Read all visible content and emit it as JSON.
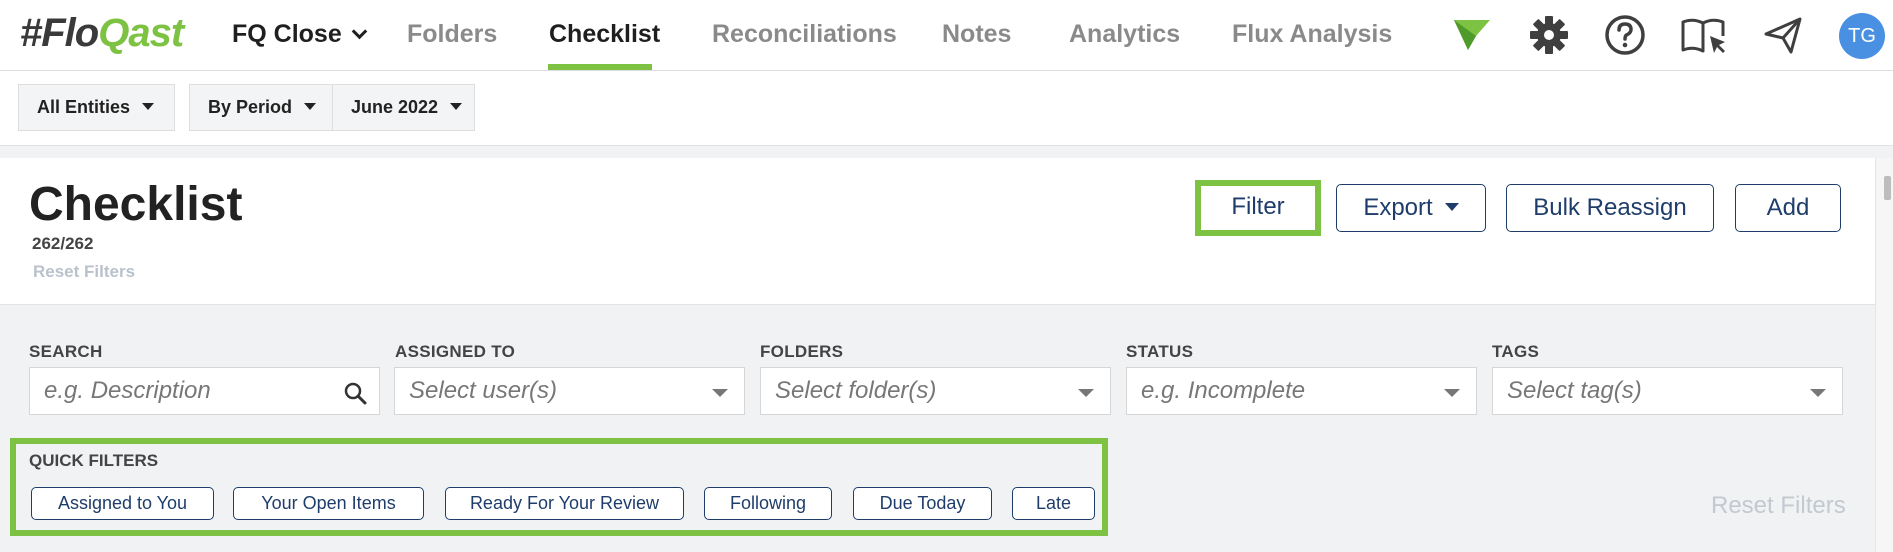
{
  "nav": {
    "logo_hash": "#",
    "logo_flo": "Flo",
    "logo_qast": "Qast",
    "workspace": "FQ Close",
    "tabs": [
      "Folders",
      "Checklist",
      "Reconciliations",
      "Notes",
      "Analytics",
      "Flux Analysis"
    ],
    "active_tab": "Checklist",
    "avatar_initials": "TG",
    "icons": [
      "brand-flag-icon",
      "gear-icon",
      "help-icon",
      "guide-book-icon",
      "send-icon"
    ]
  },
  "subbar": {
    "entities": "All Entities",
    "period_mode": "By Period",
    "period": "June 2022"
  },
  "header": {
    "title": "Checklist",
    "count": "262/262",
    "reset_filters": "Reset Filters",
    "buttons": {
      "filter": "Filter",
      "export": "Export",
      "bulk_reassign": "Bulk Reassign",
      "add": "Add"
    }
  },
  "filters": {
    "search": {
      "label": "SEARCH",
      "placeholder": "e.g. Description"
    },
    "assigned_to": {
      "label": "ASSIGNED TO",
      "placeholder": "Select user(s)"
    },
    "folders": {
      "label": "FOLDERS",
      "placeholder": "Select folder(s)"
    },
    "status": {
      "label": "STATUS",
      "placeholder": "e.g. Incomplete"
    },
    "tags": {
      "label": "TAGS",
      "placeholder": "Select tag(s)"
    }
  },
  "quick_filters": {
    "label": "QUICK FILTERS",
    "items": [
      "Assigned to You",
      "Your Open Items",
      "Ready For Your Review",
      "Following",
      "Due Today",
      "Late"
    ],
    "reset": "Reset Filters"
  },
  "colors": {
    "accent": "#7dc242",
    "primary": "#1f3d6b",
    "avatar": "#4a90e2"
  }
}
